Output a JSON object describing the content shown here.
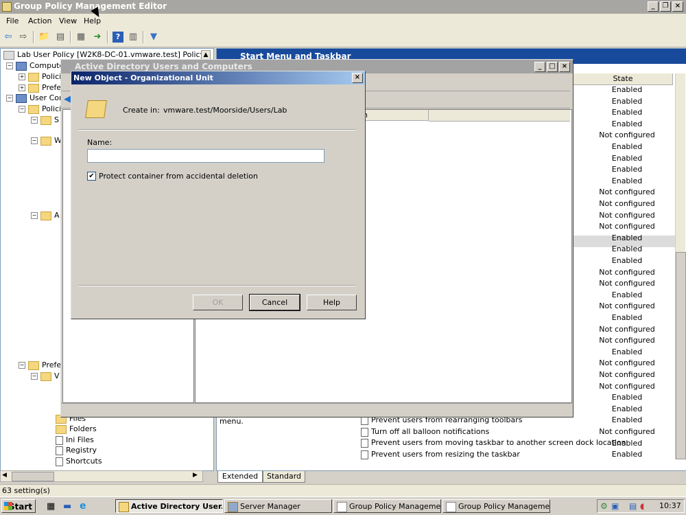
{
  "app": {
    "title": "Group Policy Management Editor",
    "menu": [
      "File",
      "Action",
      "View",
      "Help"
    ]
  },
  "tree": {
    "root": "Lab User Policy [W2K8-DC-01.vmware.test] Policy",
    "items": [
      "Compute",
      "Polici",
      "Prefe",
      "User Con",
      "Polici",
      "S",
      "W",
      "A",
      "Prefe",
      "V"
    ],
    "bottom_items": [
      "Files",
      "Folders",
      "Ini Files",
      "Registry",
      "Shortcuts"
    ]
  },
  "right": {
    "header": "Start Menu and Taskbar",
    "state_col": "State",
    "col_partial": "n",
    "left_text": "menu.",
    "states": [
      "Enabled",
      "Enabled",
      "Enabled",
      "Enabled",
      "Not configured",
      "Enabled",
      "Enabled",
      "Enabled",
      "Enabled",
      "Not configured",
      "Not configured",
      "Not configured",
      "Not configured",
      "Enabled",
      "Enabled",
      "Enabled",
      "Not configured",
      "Not configured",
      "Enabled",
      "Not configured",
      "Enabled",
      "Not configured",
      "Not configured",
      "Enabled",
      "Not configured",
      "Not configured",
      "Not configured",
      "Enabled",
      "Enabled",
      "Enabled",
      "Not configured",
      "Enabled",
      "Enabled"
    ],
    "settings": [
      "Prevent users from rearranging toolbars",
      "Turn off all balloon notifications",
      "Prevent users from moving taskbar to another screen dock location",
      "Prevent users from resizing the taskbar"
    ],
    "tabs": [
      "Extended",
      "Standard"
    ]
  },
  "status": "63 setting(s)",
  "aduc": {
    "title": "Active Directory Users and Computers"
  },
  "dialog": {
    "title": "New Object - Organizational Unit",
    "create_in_label": "Create in:",
    "create_in_path": "vmware.test/Moorside/Users/Lab",
    "name_label": "Name:",
    "name_value": "",
    "protect_label": "Protect container from accidental deletion",
    "protect_checked": true,
    "ok": "OK",
    "cancel": "Cancel",
    "help": "Help"
  },
  "taskbar": {
    "start": "Start",
    "items": [
      "Active Directory User...",
      "Server Manager",
      "Group Policy Managemen...",
      "Group Policy Managemen..."
    ],
    "clock": "10:37"
  }
}
